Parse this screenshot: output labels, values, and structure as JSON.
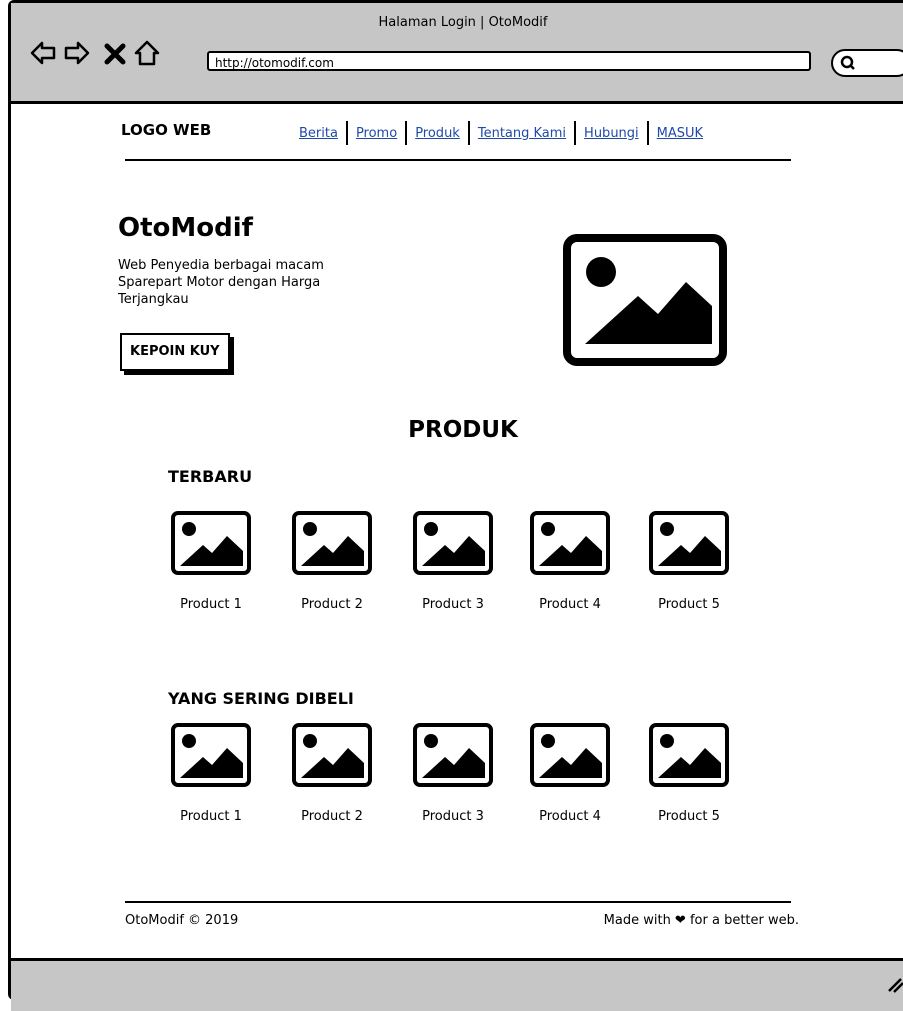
{
  "browser": {
    "title": "Halaman Login | OtoModif",
    "url": "http://otomodif.com",
    "icons": [
      "back-arrow-icon",
      "forward-arrow-icon",
      "stop-icon",
      "home-icon",
      "search-icon"
    ]
  },
  "header": {
    "logo": "LOGO WEB",
    "nav": [
      "Berita",
      "Promo",
      "Produk",
      "Tentang Kami",
      "Hubungi",
      "MASUK"
    ]
  },
  "hero": {
    "title": "OtoModif",
    "description": "Web Penyedia berbagai macam Sparepart Motor dengan Harga Terjangkau",
    "button": "KEPOIN KUY",
    "image_icon": "image-placeholder-icon"
  },
  "products": {
    "title": "PRODUK",
    "sections": [
      {
        "title": "TERBARU",
        "items": [
          "Product 1",
          "Product 2",
          "Product 3",
          "Product 4",
          "Product 5"
        ]
      },
      {
        "title": "YANG SERING DIBELI",
        "items": [
          "Product 1",
          "Product 2",
          "Product 3",
          "Product 4",
          "Product 5"
        ]
      }
    ]
  },
  "footer": {
    "copyright": "OtoModif © 2019",
    "tagline": "Made with ❤ for a better web."
  }
}
